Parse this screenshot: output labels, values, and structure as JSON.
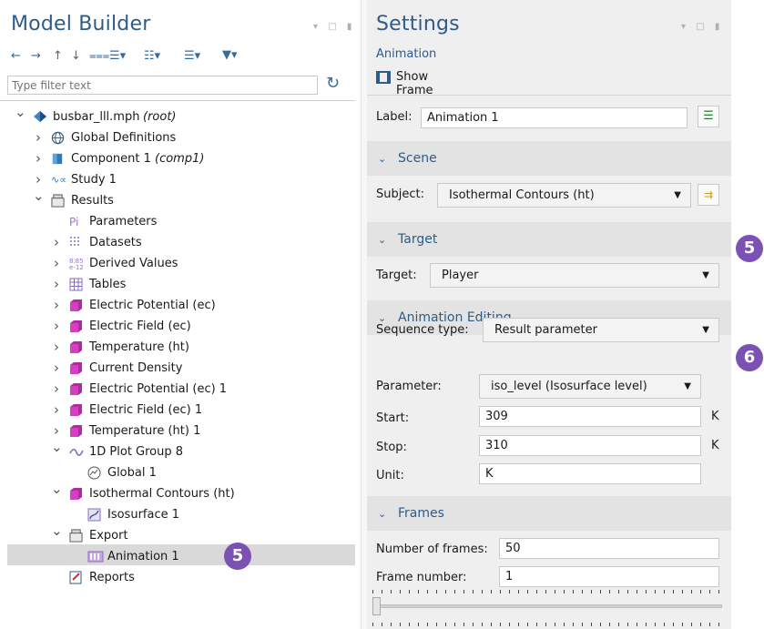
{
  "model_builder": {
    "title": "Model Builder",
    "filter_placeholder": "Type filter text",
    "tree": [
      {
        "label": "busbar_lll.mph",
        "suffix": "(root)",
        "icon": "comsol-model-icon",
        "chevron": "v"
      },
      {
        "label": "Global Definitions",
        "suffix": "",
        "icon": "globe-icon",
        "chevron": ">"
      },
      {
        "label": "Component 1",
        "suffix": "(comp1)",
        "icon": "component-icon",
        "chevron": ">"
      },
      {
        "label": "Study 1",
        "suffix": "",
        "icon": "study-icon",
        "chevron": ">"
      },
      {
        "label": "Results",
        "suffix": "",
        "icon": "results-icon",
        "chevron": "v"
      },
      {
        "label": "Parameters",
        "suffix": "",
        "icon": "parameters-icon",
        "chevron": ""
      },
      {
        "label": "Datasets",
        "suffix": "",
        "icon": "datasets-icon",
        "chevron": ">"
      },
      {
        "label": "Derived Values",
        "suffix": "",
        "icon": "derived-values-icon",
        "chevron": ">"
      },
      {
        "label": "Tables",
        "suffix": "",
        "icon": "table-icon",
        "chevron": ">"
      },
      {
        "label": "Electric Potential (ec)",
        "suffix": "",
        "icon": "plot-group-3d-icon",
        "chevron": ">"
      },
      {
        "label": "Electric Field (ec)",
        "suffix": "",
        "icon": "plot-group-3d-icon",
        "chevron": ">"
      },
      {
        "label": "Temperature (ht)",
        "suffix": "",
        "icon": "plot-group-3d-icon",
        "chevron": ">"
      },
      {
        "label": "Current Density",
        "suffix": "",
        "icon": "plot-group-3d-icon",
        "chevron": ">"
      },
      {
        "label": "Electric Potential (ec) 1",
        "suffix": "",
        "icon": "plot-group-3d-icon",
        "chevron": ">"
      },
      {
        "label": "Electric Field (ec) 1",
        "suffix": "",
        "icon": "plot-group-3d-icon",
        "chevron": ">"
      },
      {
        "label": "Temperature (ht) 1",
        "suffix": "",
        "icon": "plot-group-3d-icon",
        "chevron": ">"
      },
      {
        "label": "1D Plot Group 8",
        "suffix": "",
        "icon": "plot-1d-icon",
        "chevron": "v"
      },
      {
        "label": "Global 1",
        "suffix": "",
        "icon": "global-plot-icon",
        "chevron": ""
      },
      {
        "label": "Isothermal Contours (ht)",
        "suffix": "",
        "icon": "plot-group-3d-icon",
        "chevron": "v"
      },
      {
        "label": "Isosurface 1",
        "suffix": "",
        "icon": "isosurface-icon",
        "chevron": ""
      },
      {
        "label": "Export",
        "suffix": "",
        "icon": "export-icon",
        "chevron": "v"
      },
      {
        "label": "Animation 1",
        "suffix": "",
        "icon": "animation-icon",
        "chevron": ""
      },
      {
        "label": "Reports",
        "suffix": "",
        "icon": "reports-icon",
        "chevron": ""
      }
    ],
    "callout_badge": "5"
  },
  "settings": {
    "title": "Settings",
    "subtitle": "Animation",
    "show_frame": "Show Frame",
    "label_caption": "Label:",
    "label_value": "Animation 1",
    "scene": {
      "header": "Scene",
      "subject_caption": "Subject:",
      "subject_value": "Isothermal Contours (ht)"
    },
    "target": {
      "header": "Target",
      "target_caption": "Target:",
      "target_value": "Player",
      "badge": "5"
    },
    "animation_editing": {
      "header": "Animation Editing",
      "sequence_caption": "Sequence type:",
      "sequence_value": "Result parameter",
      "parameter_caption": "Parameter:",
      "parameter_value": "iso_level (Isosurface level)",
      "start_caption": "Start:",
      "start_value": "309",
      "start_unit": "K",
      "stop_caption": "Stop:",
      "stop_value": "310",
      "stop_unit": "K",
      "unit_caption": "Unit:",
      "unit_value": "K",
      "badge": "6"
    },
    "frames": {
      "header": "Frames",
      "num_frames_caption": "Number of frames:",
      "num_frames_value": "50",
      "frame_number_caption": "Frame number:",
      "frame_number_value": "1",
      "slider_value": 1
    }
  },
  "colors": {
    "accent": "#2e5b88",
    "badge": "#7b52b4",
    "selection": "#d9d9d9"
  }
}
